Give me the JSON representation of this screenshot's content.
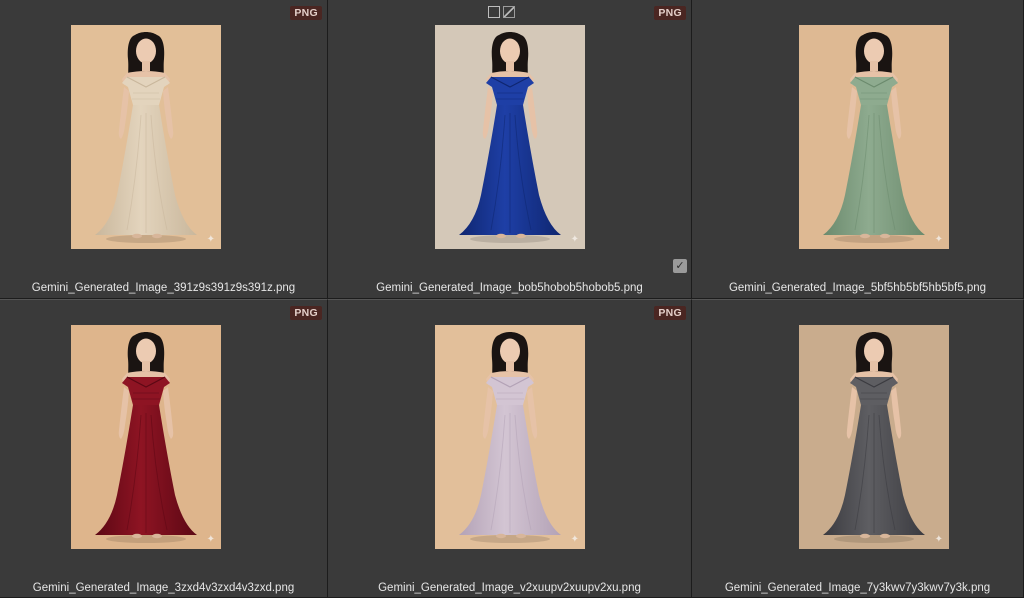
{
  "items": [
    {
      "filename": "Gemini_Generated_Image_391z9s391z9s391z.png",
      "badge": "PNG",
      "dress_color": "#e3d4bd",
      "dress_shade": "#c9b79c",
      "bg_color": "#e2bf98"
    },
    {
      "filename": "Gemini_Generated_Image_bob5hobob5hobob5.png",
      "badge": "PNG",
      "dress_color": "#1e3fa6",
      "dress_shade": "#0f2670",
      "bg_color": "#d4c8b8"
    },
    {
      "filename": "Gemini_Generated_Image_5bf5hb5bf5hb5bf5.png",
      "badge": "",
      "dress_color": "#8eab8f",
      "dress_shade": "#6b8a6d",
      "bg_color": "#deb993"
    },
    {
      "filename": "Gemini_Generated_Image_3zxd4v3zxd4v3zxd.png",
      "badge": "PNG",
      "dress_color": "#8e1423",
      "dress_shade": "#5c0814",
      "bg_color": "#deb58c"
    },
    {
      "filename": "Gemini_Generated_Image_v2xuupv2xuupv2xu.png",
      "badge": "PNG",
      "dress_color": "#d3c5d3",
      "dress_shade": "#b3a2b6",
      "bg_color": "#e2bf9a"
    },
    {
      "filename": "Gemini_Generated_Image_7y3kwv7y3kwv7y3k.png",
      "badge": "",
      "dress_color": "#5e5e62",
      "dress_shade": "#3b3b40",
      "bg_color": "#c9ac8d"
    }
  ],
  "selected_index": 1,
  "icons": {
    "sparkle": "✦",
    "check": "✓"
  }
}
